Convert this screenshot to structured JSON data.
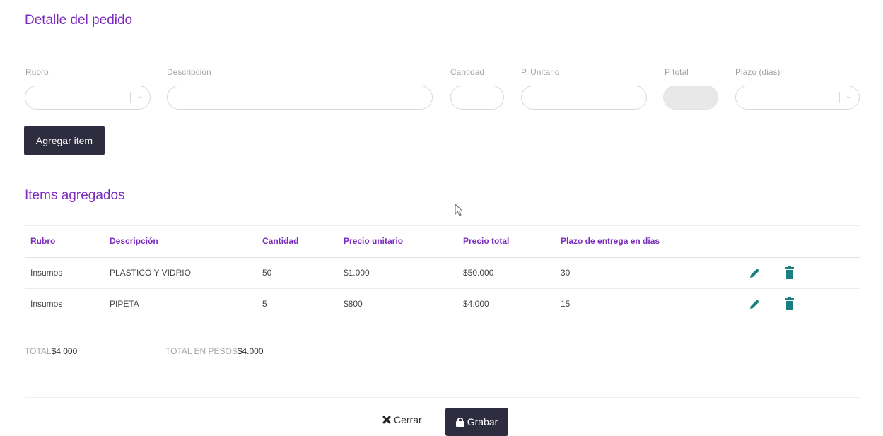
{
  "page": {
    "title": "Detalle del pedido"
  },
  "form": {
    "rubro_label": "Rubro",
    "descripcion_label": "Descripción",
    "cantidad_label": "Cantidad",
    "unitario_label": "P. Unitario",
    "total_label": "P total",
    "plazo_label": "Plazo (dias)",
    "select_arrow": "⌄",
    "add_button": "Agregar item"
  },
  "items": {
    "title": "Items agregados",
    "headers": [
      "Rubro",
      "Descripción",
      "Cantidad",
      "Precio unitario",
      "Precio total",
      "Plazo de entrega en dias"
    ],
    "rows": [
      [
        "Insumos",
        "PLASTICO Y VIDRIO",
        "50",
        "$1.000",
        "$50.000",
        "30"
      ],
      [
        "Insumos",
        "PIPETA",
        "5",
        "$800",
        "$4.000",
        "15"
      ]
    ],
    "actions": {
      "edit": "edit-icon",
      "delete": "trash-icon"
    }
  },
  "totals": {
    "total_label": "TOTAL",
    "total_value": "$4.000",
    "pesos_label": "TOTAL EN PESOS",
    "pesos_value": "$4.000"
  },
  "footer": {
    "close_label": "Cerrar",
    "save_label": "Grabar"
  },
  "colors": {
    "accent": "#7b2cbf",
    "dark_button": "#2e2d3f",
    "icon": "#1a7f7f"
  }
}
